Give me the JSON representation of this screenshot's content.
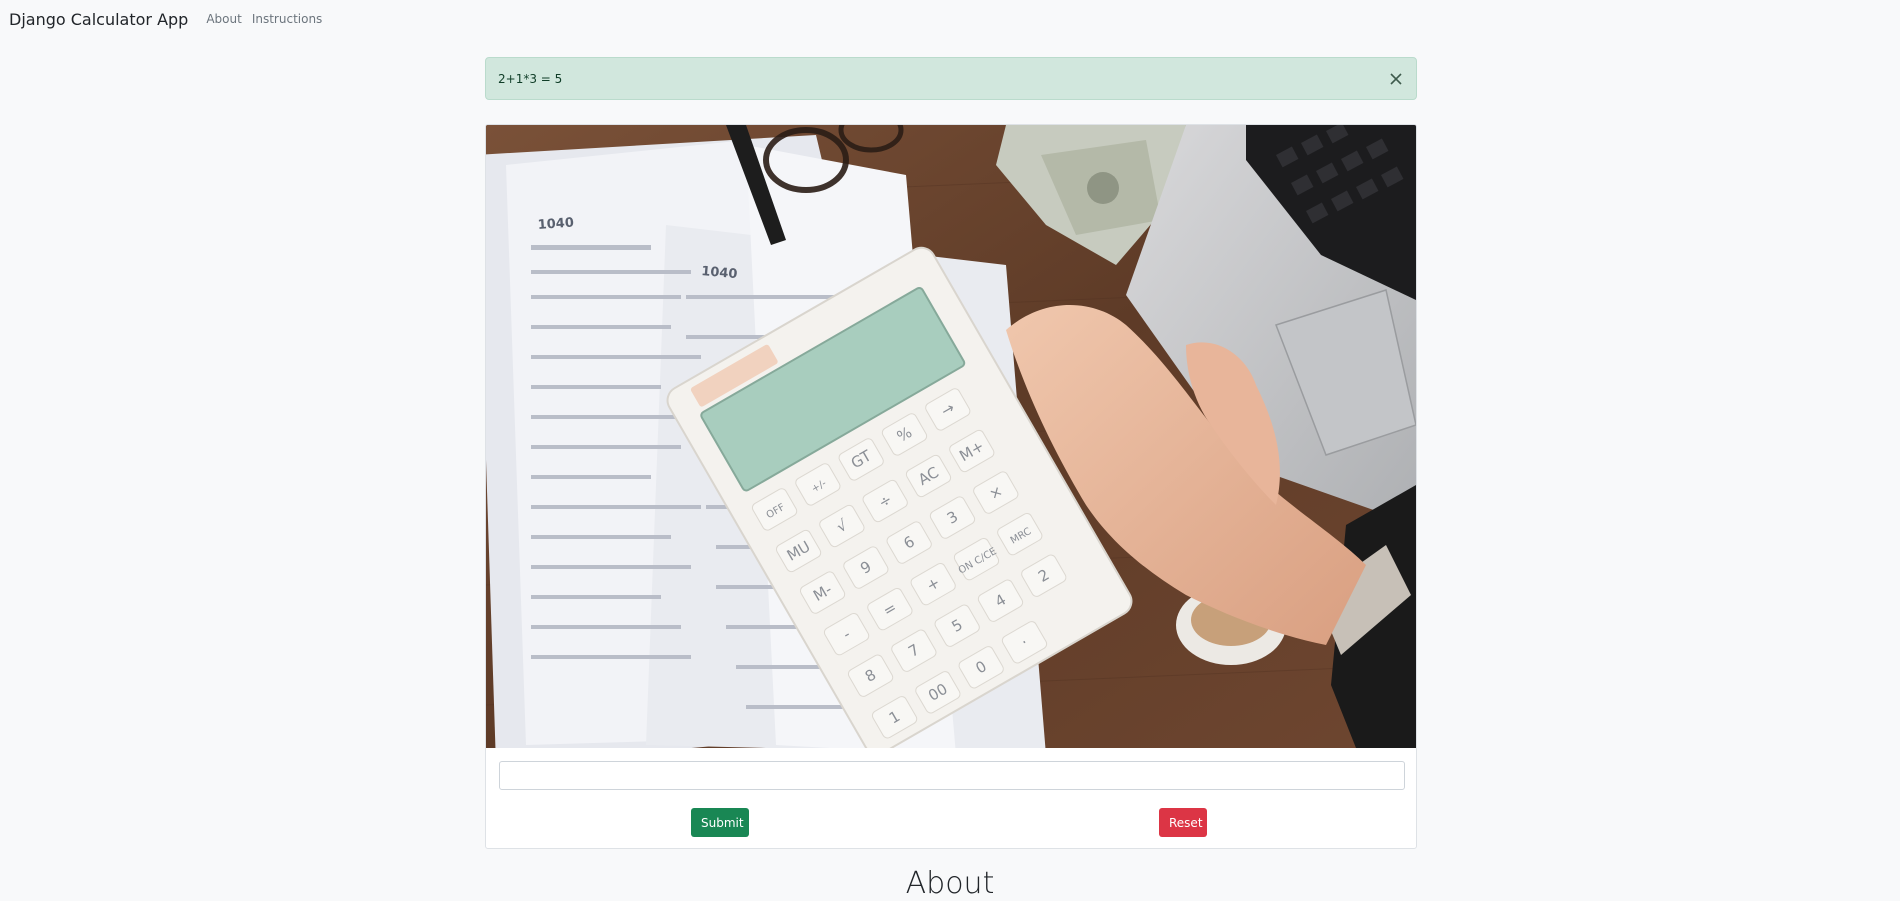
{
  "navbar": {
    "brand": "Django Calculator App",
    "links": [
      "About",
      "Instructions"
    ]
  },
  "alert": {
    "message": "2+1*3 = 5",
    "close_icon": "close-icon"
  },
  "hero_image": {
    "subject": "calculator-photo",
    "calc_keys": [
      "OFF",
      "+/-",
      "GT",
      "%",
      "→",
      "MU",
      "√",
      "÷",
      "AC",
      "M+",
      "M-",
      "9",
      "6",
      "3",
      "×",
      "-",
      "=",
      "+",
      "ON C/CE",
      "MRC",
      "8",
      "7",
      "5",
      "4",
      "2",
      "1",
      "00",
      "0",
      "·"
    ],
    "form_label": "1040"
  },
  "form": {
    "expression_value": "",
    "expression_placeholder": "",
    "submit_label": "Submit",
    "reset_label": "Reset"
  },
  "section": {
    "heading": "About"
  },
  "colors": {
    "background": "#f8f9fa",
    "alert_bg": "#d1e7dd",
    "submit": "#198754",
    "reset": "#dc3545"
  }
}
